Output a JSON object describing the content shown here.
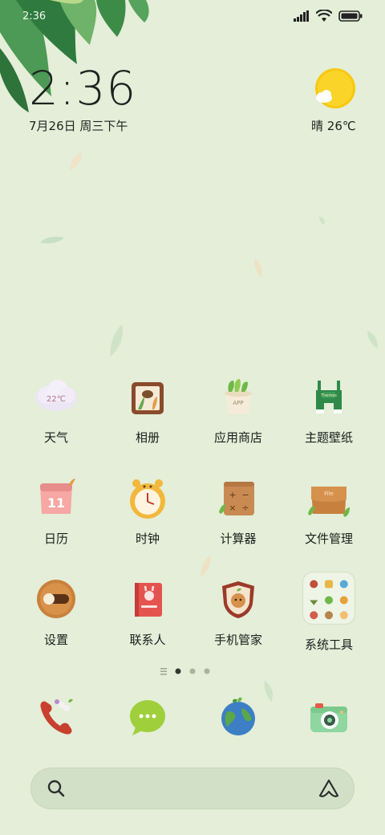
{
  "status_bar": {
    "time": "2:36",
    "icons": [
      "signal-icon",
      "wifi-icon",
      "battery-icon"
    ]
  },
  "clock_widget": {
    "time": "2:36",
    "date": "7月26日 周三下午"
  },
  "weather_widget": {
    "condition": "晴",
    "temperature": "26℃",
    "icon": "sun-with-cloud-icon"
  },
  "apps": [
    {
      "label": "天气",
      "icon": "weather-cloud-icon",
      "badge_text": "22℃"
    },
    {
      "label": "相册",
      "icon": "gallery-icon"
    },
    {
      "label": "应用商店",
      "icon": "app-store-icon",
      "badge_text": "APP"
    },
    {
      "label": "主题壁纸",
      "icon": "themes-overalls-icon",
      "badge_text": "Themes"
    },
    {
      "label": "日历",
      "icon": "calendar-icon",
      "badge_text": "11"
    },
    {
      "label": "时钟",
      "icon": "clock-icon"
    },
    {
      "label": "计算器",
      "icon": "calculator-icon"
    },
    {
      "label": "文件管理",
      "icon": "file-folder-icon",
      "badge_text": "File"
    },
    {
      "label": "设置",
      "icon": "settings-toggle-icon"
    },
    {
      "label": "联系人",
      "icon": "contacts-book-icon"
    },
    {
      "label": "手机管家",
      "icon": "security-shield-icon"
    },
    {
      "label": "系统工具",
      "icon": "system-tools-folder-icon"
    }
  ],
  "page_indicator": {
    "pages": 3,
    "current": 1
  },
  "dock": [
    {
      "icon": "phone-icon"
    },
    {
      "icon": "messages-icon"
    },
    {
      "icon": "browser-globe-icon"
    },
    {
      "icon": "camera-icon"
    }
  ],
  "search_bar": {
    "icons": [
      "search-icon",
      "assistant-icon"
    ]
  },
  "colors": {
    "background": "#e4eed8",
    "leaf_dark": "#3f8a4a",
    "sun": "#f9c80e",
    "search_bar": "#d3e0c8"
  }
}
